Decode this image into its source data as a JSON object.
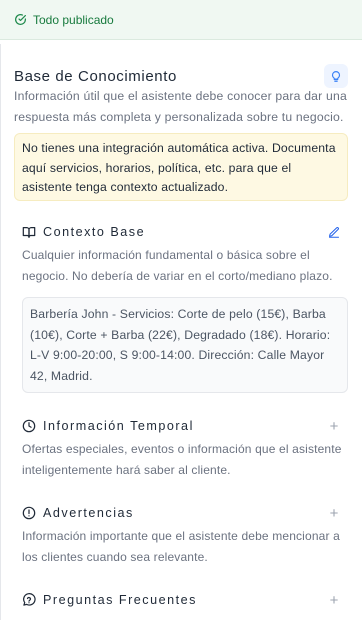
{
  "status": {
    "label": "Todo publicado",
    "color": "#177a3d"
  },
  "header": {
    "title": "Base de Conocimiento",
    "subtitle": "Información útil que el asistente debe conocer para dar una respuesta más completa y personalizada sobre tu negocio.",
    "help_icon": "lightbulb-icon"
  },
  "notice": {
    "text": "No tienes una integración automática activa. Documenta aquí servicios, horarios, política, etc. para que el asistente tenga contexto actualizado."
  },
  "sections": [
    {
      "icon": "book-open-icon",
      "title": "Contexto Base",
      "description": "Cualquier información fundamental o básica sobre el negocio. No debería de variar en el corto/mediano plazo.",
      "action_icon": "pencil-icon",
      "content": "Barbería John - Servicios: Corte de pelo (15€), Barba (10€), Corte + Barba (22€), Degradado (18€). Horario: L-V 9:00-20:00, S 9:00-14:00. Dirección: Calle Mayor 42, Madrid."
    },
    {
      "icon": "clock-icon",
      "title": "Información Temporal",
      "description": "Ofertas especiales, eventos o información que el asistente inteligentemente hará saber al cliente.",
      "action_icon": "plus-icon",
      "action_label": "+"
    },
    {
      "icon": "alert-circle-icon",
      "title": "Advertencias",
      "description": "Información importante que el asistente debe mencionar a los clientes cuando sea relevante.",
      "action_icon": "plus-icon",
      "action_label": "+"
    },
    {
      "icon": "question-bubble-icon",
      "title": "Preguntas Frecuentes",
      "action_icon": "plus-icon",
      "action_label": "+"
    }
  ],
  "colors": {
    "accent": "#2563eb",
    "notice_bg": "#fef9e3",
    "status_bg": "#f0f8f2"
  }
}
